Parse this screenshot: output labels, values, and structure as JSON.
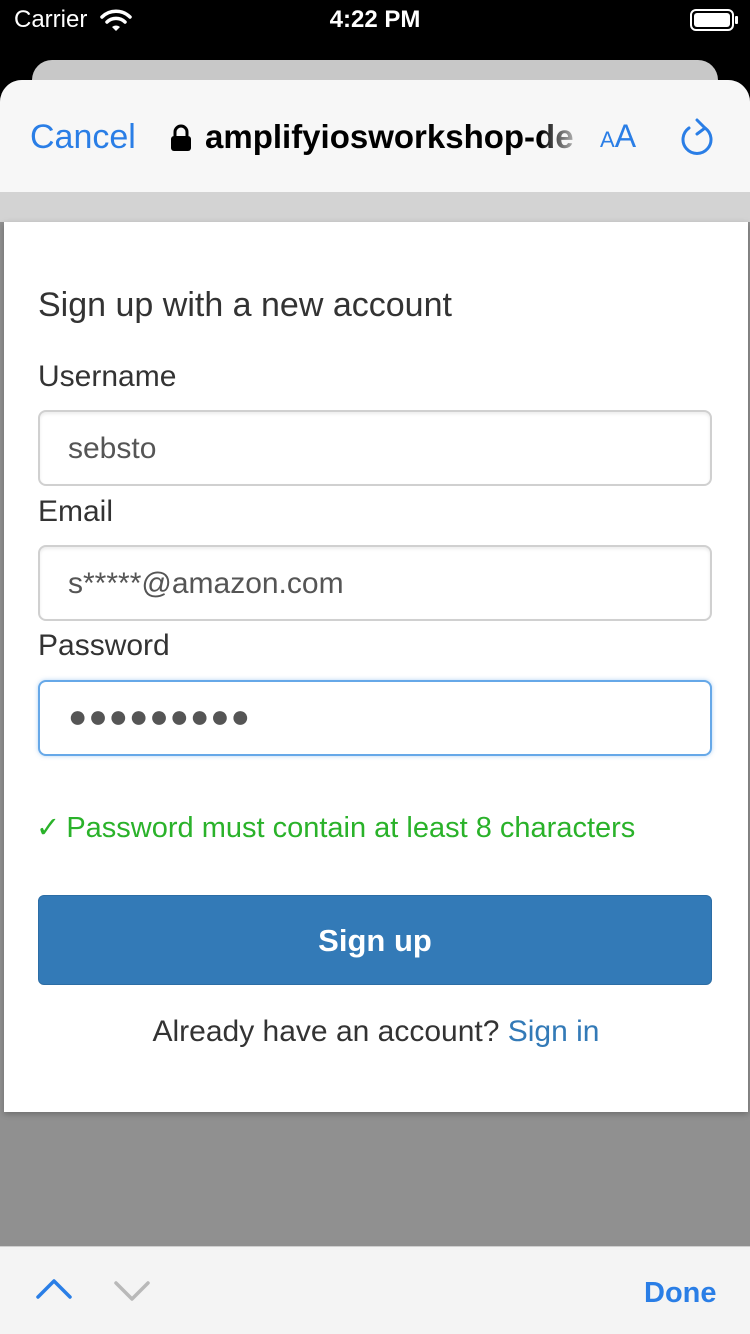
{
  "status_bar": {
    "carrier": "Carrier",
    "time": "4:22 PM",
    "icons": [
      "wifi-icon",
      "battery-icon"
    ]
  },
  "browser": {
    "cancel_label": "Cancel",
    "url": "amplifyiosworkshop-de",
    "text_size_small": "A",
    "text_size_big": "A",
    "icons": [
      "lock-icon",
      "reload-icon"
    ],
    "accent_color": "#2a7ee6"
  },
  "form": {
    "title": "Sign up with a new account",
    "username_label": "Username",
    "username_value": "sebsto",
    "email_label": "Email",
    "email_value": "s*****@amazon.com",
    "password_label": "Password",
    "password_value": "●●●●●●●●●",
    "password_hint_check": "✓",
    "password_hint": "Password must contain at least 8 characters",
    "signup_label": "Sign up",
    "footer_text": "Already have an account?",
    "signin_label": "Sign in",
    "button_color": "#337ab7",
    "hint_color": "#2ab22a"
  },
  "toolbar": {
    "done_label": "Done",
    "icons": [
      "chevron-up-icon",
      "chevron-down-icon"
    ]
  }
}
